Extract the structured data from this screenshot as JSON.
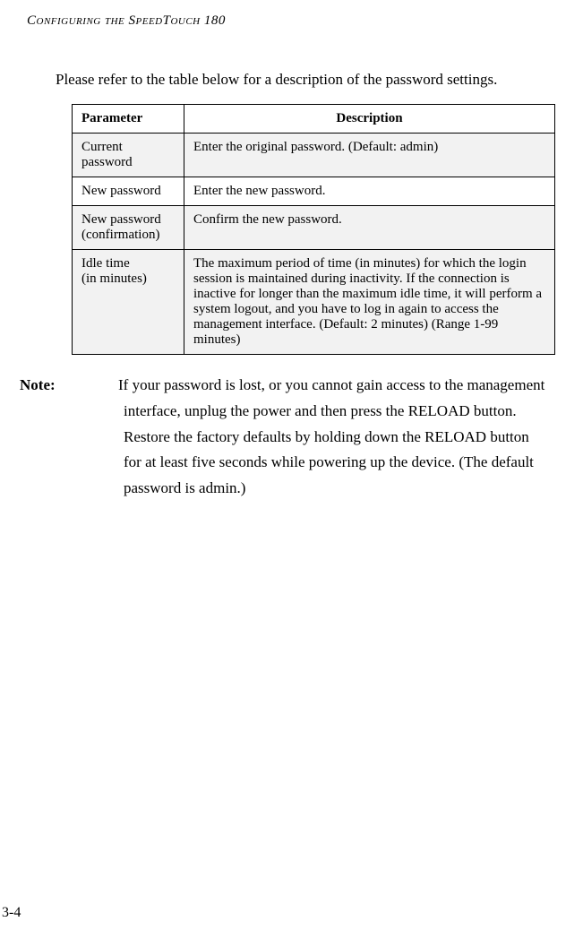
{
  "header": {
    "prefix": "Configuring the SpeedTouch",
    "num": "180"
  },
  "intro": "Please refer to the table below for a description of the password settings.",
  "table": {
    "headers": {
      "param": "Parameter",
      "desc": "Description"
    },
    "rows": [
      {
        "param": "Current password",
        "desc": "Enter the original password. (Default: admin)",
        "shaded": true
      },
      {
        "param": "New password",
        "desc": "Enter the new password.",
        "shaded": false
      },
      {
        "param": "New password (confirmation)",
        "desc": "Confirm the new password.",
        "shaded": true
      },
      {
        "param": "Idle time\n(in minutes)",
        "desc": "The maximum period of time (in minutes) for which the login session is maintained during inactivity. If the connection is inactive for longer than the maximum idle time, it will perform a system logout, and you have to log in again to access the management interface. (Default: 2 minutes) (Range 1-99 minutes)",
        "shaded": true
      }
    ]
  },
  "note": {
    "label": "Note:",
    "text": "If your password is lost, or you cannot gain access to the management interface, unplug the power and then press the RELOAD button. Restore the factory defaults by holding down the RELOAD button for at least five seconds while powering up the device. (The default password is admin.)"
  },
  "pageNumber": "3-4"
}
